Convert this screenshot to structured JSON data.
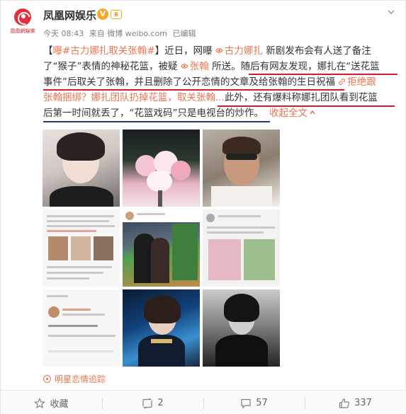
{
  "account": {
    "name": "凤凰网娱乐",
    "verified_badge": "V",
    "vip_badge": "6",
    "avatar_caption": "凰凰網娛樂"
  },
  "meta": {
    "date": "今天 08:43",
    "source": "来自 微博 weibo.com",
    "edited": "已编辑"
  },
  "post": {
    "line1": {
      "bracket_open": "【",
      "hashtag": "曝#古力娜扎取关张翰#",
      "bracket_close": "】",
      "text1": "近日，网曝 ",
      "mention1": "古力娜扎",
      "text2": " 新剧发布会有人送了备注"
    },
    "line2": {
      "text1": "了“猴子”表情的神秘花篮，被疑 ",
      "mention2": "张翰",
      "text2": " 所送。随后有网友发现，娜扎在“送花篮"
    },
    "line3": {
      "text1": "事件”后取关了张翰，并且删除了公开恋情的文章及给张翰的生日祝福 ",
      "link_text": "拒绝跟"
    },
    "line4": {
      "link_text": "张翰捆绑？娜扎团队扔掉花篮，取关张翰...",
      "text1": "此外，还有爆料称娜扎团队看到花篮"
    },
    "line5": {
      "text1": "后第一时间就丢了，“花篮戏码”只是电视台的炒作。",
      "collapse": "收起全文",
      "collapse_icon": "up-arrow"
    }
  },
  "photos": [
    {
      "alt": "古力娜扎 portrait"
    },
    {
      "alt": "flower basket"
    },
    {
      "alt": "张翰 selfie"
    },
    {
      "alt": "weibo screenshot"
    },
    {
      "alt": "couple photo"
    },
    {
      "alt": "weibo screenshot with flowers"
    },
    {
      "alt": "weibo post screenshot"
    },
    {
      "alt": "stage photo"
    },
    {
      "alt": "black and white portrait"
    }
  ],
  "source_tag": "明星恋情追踪",
  "footer": {
    "favorite": "收藏",
    "repost": "2",
    "comment": "57",
    "like": "337"
  },
  "colors": {
    "accent": "#eb7350",
    "red_underline": "#d6192c",
    "blue_underline": "#1b3a8c"
  }
}
